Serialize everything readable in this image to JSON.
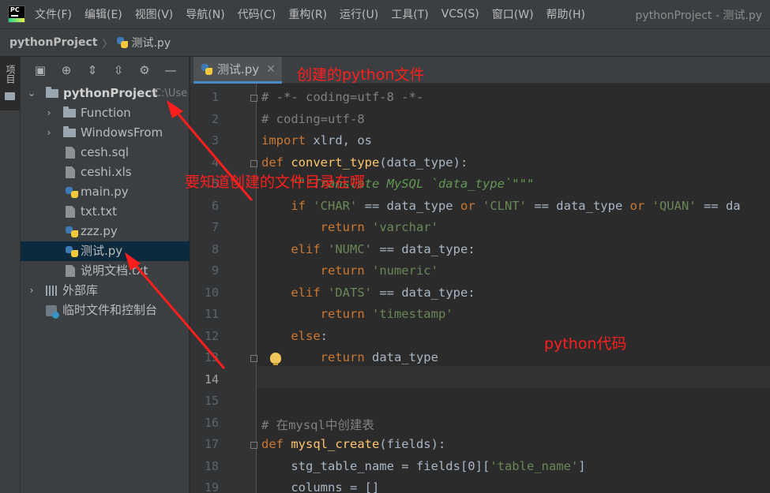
{
  "app": {
    "logo_icon": "pycharm-logo-icon",
    "logo_text": "PC",
    "window_title": "pythonProject - 测试.py"
  },
  "menu": [
    "文件(F)",
    "编辑(E)",
    "视图(V)",
    "导航(N)",
    "代码(C)",
    "重构(R)",
    "运行(U)",
    "工具(T)",
    "VCS(S)",
    "窗口(W)",
    "帮助(H)"
  ],
  "breadcrumb": {
    "project": "pythonProject",
    "separator": "〉",
    "file": "测试.py"
  },
  "toolstrip": {
    "project_label": "项目"
  },
  "project_panel": {
    "toolbar_icons": [
      "layout-icon",
      "target-icon",
      "expand-all-icon",
      "collapse-all-icon",
      "gear-icon",
      "minimize-icon"
    ],
    "tree": [
      {
        "label": "pythonProject",
        "path": "C:\\Use",
        "kind": "root-folder",
        "expanded": true
      },
      {
        "label": "Function",
        "kind": "folder",
        "expanded": false
      },
      {
        "label": "WindowsFrom",
        "kind": "folder",
        "expanded": false
      },
      {
        "label": "cesh.sql",
        "kind": "sql-file"
      },
      {
        "label": "ceshi.xls",
        "kind": "xls-file"
      },
      {
        "label": "main.py",
        "kind": "python-file"
      },
      {
        "label": "txt.txt",
        "kind": "text-file"
      },
      {
        "label": "zzz.py",
        "kind": "python-file"
      },
      {
        "label": "测试.py",
        "kind": "python-file",
        "selected": true
      },
      {
        "label": "说明文档.txt",
        "kind": "text-file"
      },
      {
        "label": "外部库",
        "kind": "library",
        "expanded": false
      },
      {
        "label": "临时文件和控制台",
        "kind": "scratches"
      }
    ]
  },
  "editor": {
    "tab": {
      "label": "测试.py",
      "close_glyph": "✕"
    },
    "line_numbers": [
      "1",
      "2",
      "3",
      "4",
      "5",
      "6",
      "7",
      "8",
      "9",
      "10",
      "11",
      "12",
      "13",
      "14",
      "15",
      "16",
      "17",
      "18",
      "19"
    ],
    "current_line": "14",
    "code": [
      [
        {
          "t": "cmt",
          "v": "# -*- coding=utf-8 -*-"
        }
      ],
      [
        {
          "t": "cmt",
          "v": "# coding=utf-8"
        }
      ],
      [
        {
          "t": "kw",
          "v": "import "
        },
        {
          "t": "plain",
          "v": "xlrd, os"
        }
      ],
      [
        {
          "t": "kw",
          "v": "def "
        },
        {
          "t": "fn",
          "v": "convert_type"
        },
        {
          "t": "plain",
          "v": "(data_type):"
        }
      ],
      [
        {
          "t": "doc",
          "v": "    \"\"\"Translate MySQL `data_type`\"\"\""
        }
      ],
      [
        {
          "t": "plain",
          "v": "    "
        },
        {
          "t": "kw",
          "v": "if "
        },
        {
          "t": "str",
          "v": "'CHAR'"
        },
        {
          "t": "plain",
          "v": " == data_type "
        },
        {
          "t": "kw",
          "v": "or "
        },
        {
          "t": "str",
          "v": "'CLNT'"
        },
        {
          "t": "plain",
          "v": " == data_type "
        },
        {
          "t": "kw",
          "v": "or "
        },
        {
          "t": "str",
          "v": "'QUAN'"
        },
        {
          "t": "plain",
          "v": " == da"
        }
      ],
      [
        {
          "t": "plain",
          "v": "        "
        },
        {
          "t": "kw",
          "v": "return "
        },
        {
          "t": "str",
          "v": "'varchar'"
        }
      ],
      [
        {
          "t": "plain",
          "v": "    "
        },
        {
          "t": "kw",
          "v": "elif "
        },
        {
          "t": "str",
          "v": "'NUMC'"
        },
        {
          "t": "plain",
          "v": " == data_type:"
        }
      ],
      [
        {
          "t": "plain",
          "v": "        "
        },
        {
          "t": "kw",
          "v": "return "
        },
        {
          "t": "str",
          "v": "'numeric'"
        }
      ],
      [
        {
          "t": "plain",
          "v": "    "
        },
        {
          "t": "kw",
          "v": "elif "
        },
        {
          "t": "str",
          "v": "'DATS'"
        },
        {
          "t": "plain",
          "v": " == data_type:"
        }
      ],
      [
        {
          "t": "plain",
          "v": "        "
        },
        {
          "t": "kw",
          "v": "return "
        },
        {
          "t": "str",
          "v": "'timestamp'"
        }
      ],
      [
        {
          "t": "plain",
          "v": "    "
        },
        {
          "t": "kw",
          "v": "else"
        },
        {
          "t": "plain",
          "v": ":"
        }
      ],
      [
        {
          "t": "plain",
          "v": "        "
        },
        {
          "t": "kw",
          "v": "return "
        },
        {
          "t": "plain",
          "v": "data_type"
        }
      ],
      [
        {
          "t": "plain",
          "v": ""
        }
      ],
      [
        {
          "t": "plain",
          "v": ""
        }
      ],
      [
        {
          "t": "cmt",
          "v": "# 在mysql中创建表"
        }
      ],
      [
        {
          "t": "kw",
          "v": "def "
        },
        {
          "t": "fn",
          "v": "mysql_create"
        },
        {
          "t": "plain",
          "v": "(fields):"
        }
      ],
      [
        {
          "t": "plain",
          "v": "    stg_table_name = fields["
        },
        {
          "t": "plain",
          "v": "0"
        },
        {
          "t": "plain",
          "v": "]["
        },
        {
          "t": "str",
          "v": "'table_name'"
        },
        {
          "t": "plain",
          "v": "]"
        }
      ],
      [
        {
          "t": "plain",
          "v": "    columns = []"
        }
      ]
    ]
  },
  "annotations": {
    "created_file": "创建的python文件",
    "where_created": "要知道创建的文件目录在哪",
    "python_code": "python代码",
    "color": "#ff1e1e"
  }
}
